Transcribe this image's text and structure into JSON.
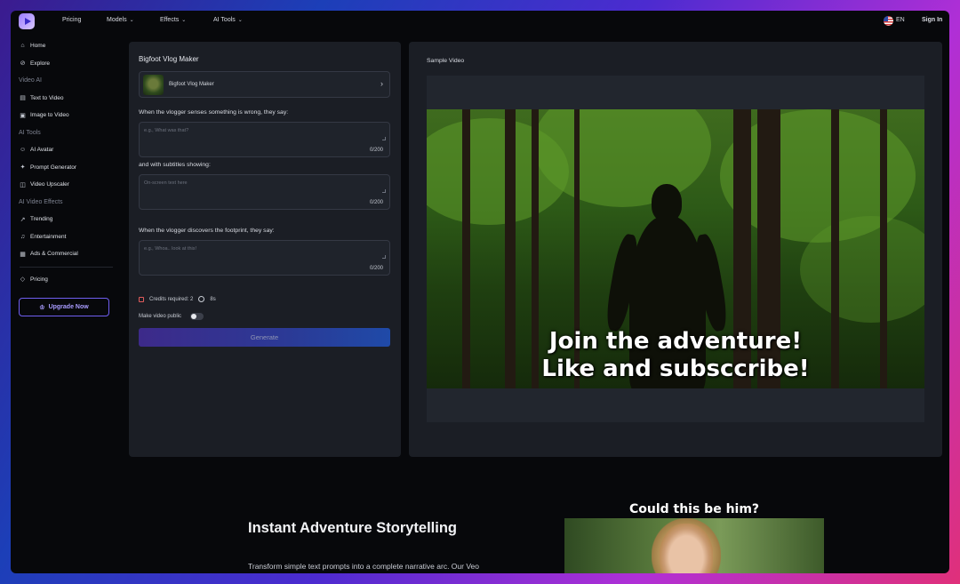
{
  "nav": {
    "items": [
      {
        "label": "Pricing",
        "chevron": false
      },
      {
        "label": "Models",
        "chevron": true
      },
      {
        "label": "Effects",
        "chevron": true
      },
      {
        "label": "AI Tools",
        "chevron": true
      }
    ],
    "language": "EN",
    "sign_in": "Sign In"
  },
  "sidebar": {
    "home": "Home",
    "explore": "Explore",
    "section_video_ai": "Video AI",
    "text_to_video": "Text to Video",
    "image_to_video": "Image to Video",
    "section_ai_tools": "AI Tools",
    "ai_avatar": "AI Avatar",
    "prompt_generator": "Prompt Generator",
    "video_upscaler": "Video Upscaler",
    "section_effects": "AI Video Effects",
    "trending": "Trending",
    "entertainment": "Entertainment",
    "ads_commercial": "Ads & Commercial",
    "pricing": "Pricing",
    "upgrade": "Upgrade Now"
  },
  "form": {
    "title": "Bigfoot Vlog Maker",
    "template_name": "Bigfoot Vlog Maker",
    "field1_label": "When the vlogger senses something is wrong, they say:",
    "field1_placeholder": "e.g., What was that?",
    "field1_count": "0/200",
    "field2_label": "and with subtitles showing:",
    "field2_placeholder": "On-screen text here",
    "field2_count": "0/200",
    "field3_label": "When the vlogger discovers the footprint, they say:",
    "field3_placeholder": "e.g., Whoa.. look at this!",
    "field3_count": "0/200",
    "credits": "Credits required: 2",
    "duration": "8s",
    "public_label": "Make video public",
    "public_on": false,
    "generate": "Generate"
  },
  "sample": {
    "title": "Sample Video",
    "caption_line1": "Join the adventure!",
    "caption_line2": "Like and subsccribe!"
  },
  "section": {
    "heading": "Instant Adventure Storytelling",
    "text": "Transform simple text prompts into a complete narrative arc. Our Veo",
    "promo_title": "Could this be him?"
  },
  "colors": {
    "accent": "#6f5ef0",
    "panel": "#1b1e25",
    "background": "#07080b"
  }
}
